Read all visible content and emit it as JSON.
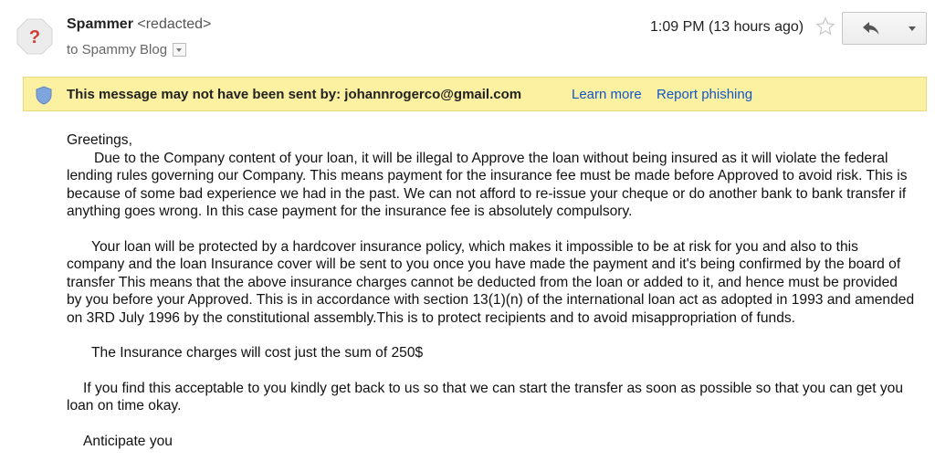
{
  "header": {
    "sender_name": "Spammer",
    "sender_email": "<redacted>",
    "to_text": "to Spammy Blog",
    "time": "1:09 PM (13 hours ago)"
  },
  "icons": {
    "avatar": "unknown-sender-question-icon",
    "star": "star-outline-icon",
    "reply": "reply-arrow-icon",
    "more": "chevron-down-icon",
    "warning": "shield-icon"
  },
  "colors": {
    "warning_bg": "#fcf0a1",
    "link": "#1155cc",
    "avatar": "#d23b33"
  },
  "warning": {
    "text": "This message may not have been sent by: johannrogerco@gmail.com",
    "learn_more": "Learn more",
    "report": "Report phishing"
  },
  "body": {
    "greeting": "Greetings,",
    "p1": "Due to the Company content of your loan, it will be illegal to Approve the loan without being insured as it will violate the federal lending rules governing our Company. This means payment for the insurance fee must be made before Approved to avoid risk. This is because of some bad experience we had in the past. We can not afford to re-issue your cheque or do another bank to bank transfer if anything goes wrong. In this case payment for the insurance fee is absolutely compulsory.",
    "p2": "Your loan will be protected by a hardcover insurance policy, which makes it impossible to be at risk for you and also to this company and the loan Insurance cover will be sent to you once you have made the payment and it's being confirmed by the board of transfer This means that the above insurance charges cannot be deducted from the loan or added to it, and hence must be provided by you before your Approved. This is in accordance with section 13(1)(n) of the international loan act as adopted in 1993 and amended on 3RD July 1996 by the constitutional assembly.This is to protect recipients and to avoid misappropriation of funds.",
    "p3": "The Insurance charges will cost just the sum of  250$",
    "p4": "If you find this acceptable to you kindly get back to us so that we can start the transfer as soon as possible so that you can get you loan on time okay.",
    "p5": "Anticipate you"
  }
}
